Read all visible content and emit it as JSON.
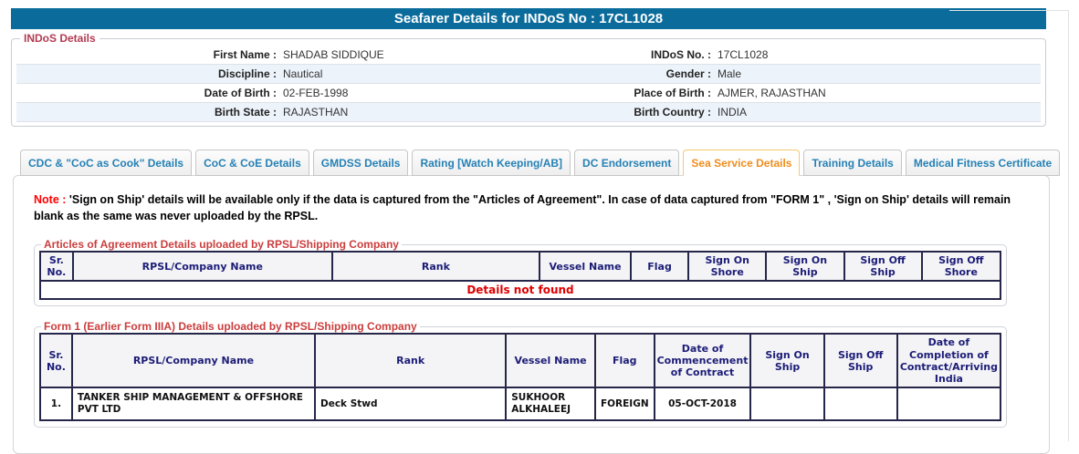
{
  "title_bar": {
    "text": "Seafarer Details for INDoS No : 17CL1028"
  },
  "indos_details": {
    "legend": "INDoS Details",
    "rows": [
      {
        "left_label": "First Name :",
        "left_value": "SHADAB SIDDIQUE",
        "right_label": "INDoS No. :",
        "right_value": "17CL1028"
      },
      {
        "left_label": "Discipline :",
        "left_value": "Nautical",
        "right_label": "Gender :",
        "right_value": "Male"
      },
      {
        "left_label": "Date of Birth :",
        "left_value": "02-FEB-1998",
        "right_label": "Place of Birth :",
        "right_value": "AJMER, RAJASTHAN"
      },
      {
        "left_label": "Birth State :",
        "left_value": "RAJASTHAN",
        "right_label": "Birth Country :",
        "right_value": "INDIA"
      }
    ]
  },
  "tabs": [
    {
      "label": "CDC & \"CoC as Cook\" Details",
      "active": false
    },
    {
      "label": "CoC & CoE Details",
      "active": false
    },
    {
      "label": "GMDSS Details",
      "active": false
    },
    {
      "label": "Rating [Watch Keeping/AB]",
      "active": false
    },
    {
      "label": "DC Endorsement",
      "active": false
    },
    {
      "label": "Sea Service Details",
      "active": true
    },
    {
      "label": "Training Details",
      "active": false
    },
    {
      "label": "Medical Fitness Certificate",
      "active": false
    }
  ],
  "note": {
    "prefix": "Note :",
    "text": "'Sign on Ship' details will be available only if the data is captured from the \"Articles of Agreement\". In case of data captured from \"FORM 1\" , 'Sign on Ship' details will remain blank as the same was never uploaded by the RPSL."
  },
  "aoa_table": {
    "legend": "Articles of Agreement Details uploaded by RPSL/Shipping Company",
    "headers": [
      "Sr. No.",
      "RPSL/Company Name",
      "Rank",
      "Vessel Name",
      "Flag",
      "Sign On Shore",
      "Sign On Ship",
      "Sign Off Ship",
      "Sign Off Shore"
    ],
    "empty_message": "Details not found"
  },
  "form1_table": {
    "legend": "Form 1 (Earlier Form IIIA) Details uploaded by RPSL/Shipping Company",
    "headers": [
      "Sr. No.",
      "RPSL/Company Name",
      "Rank",
      "Vessel Name",
      "Flag",
      "Date of Commencement of Contract",
      "Sign On Ship",
      "Sign Off Ship",
      "Date of Completion of Contract/Arriving India"
    ],
    "rows": [
      {
        "sr_no": "1.",
        "company": "TANKER SHIP MANAGEMENT & OFFSHORE PVT LTD",
        "rank": "Deck Stwd",
        "vessel": "SUKHOOR ALKHALEEJ",
        "flag": "FOREIGN",
        "date_commencement": "05-OCT-2018",
        "sign_on_ship": "",
        "sign_off_ship": "",
        "date_completion": ""
      }
    ]
  },
  "colors": {
    "title_bar_bg": "#0b6c9c",
    "tab_text": "#2581b5",
    "active_tab_text": "#ef8e1d",
    "note_highlight": "#ff0000",
    "legend_text": "#b23b52",
    "table_legend_text": "#cb3d3d",
    "table_header_text": "#1c1c78",
    "table_border": "#26264a",
    "empty_message_text": "#e00000",
    "row_alt_bg": "#edf3fb"
  }
}
